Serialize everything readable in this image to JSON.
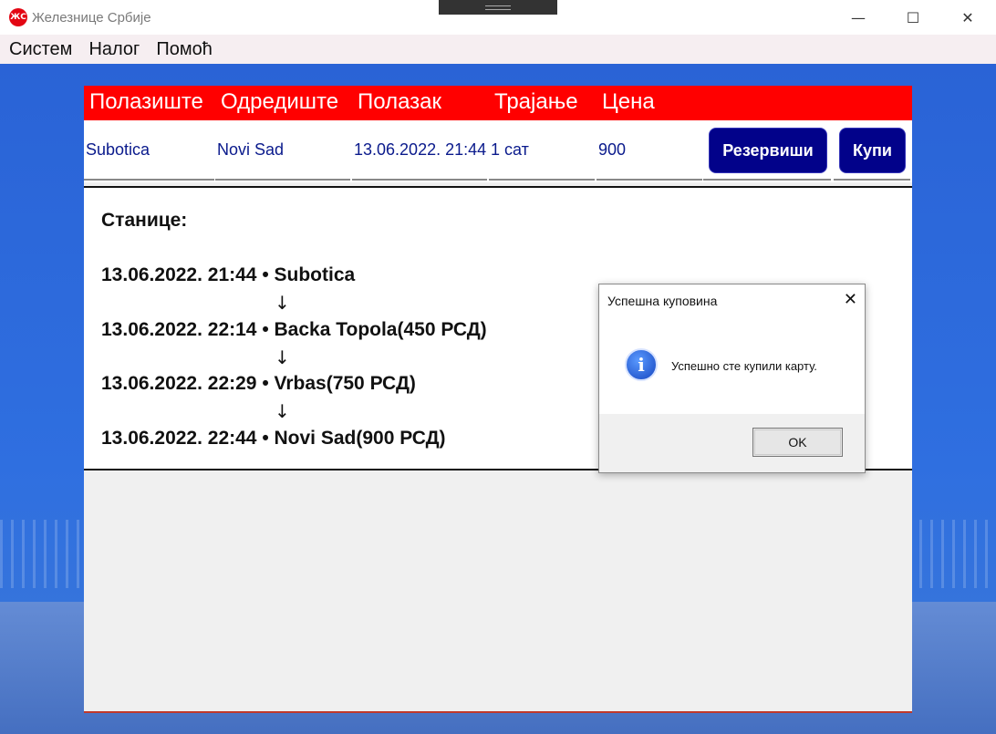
{
  "window": {
    "title": "Железнице Србије",
    "logo_text": "ЖС",
    "minimize": "—",
    "maximize": "☐",
    "close": "✕"
  },
  "menu": [
    "Систем",
    "Налог",
    "Помоћ"
  ],
  "table": {
    "headers": [
      "Полазиште",
      "Одредиште",
      "Полазак",
      "Трајање",
      "Цена"
    ],
    "row": {
      "origin": "Subotica",
      "destination": "Novi Sad",
      "departure": "13.06.2022. 21:44",
      "duration": "1 сат",
      "price": "900",
      "reserve_label": "Резервиши",
      "buy_label": "Купи"
    }
  },
  "stations": {
    "title": "Станице:",
    "stops": [
      "13.06.2022. 21:44 • Subotica",
      "13.06.2022. 22:14 • Backa Topola(450 РСД)",
      "13.06.2022. 22:29 • Vrbas(750 РСД)",
      "13.06.2022. 22:44 • Novi Sad(900 РСД)"
    ],
    "arrow": "↓"
  },
  "dialog": {
    "title": "Успешна куповина",
    "message": "Успешно сте купили карту.",
    "ok_label": "OK",
    "close": "✕",
    "icon": "i"
  },
  "colors": {
    "header_red": "#ff0000",
    "button_navy": "#02028a",
    "row_text": "#0a1a8c"
  }
}
